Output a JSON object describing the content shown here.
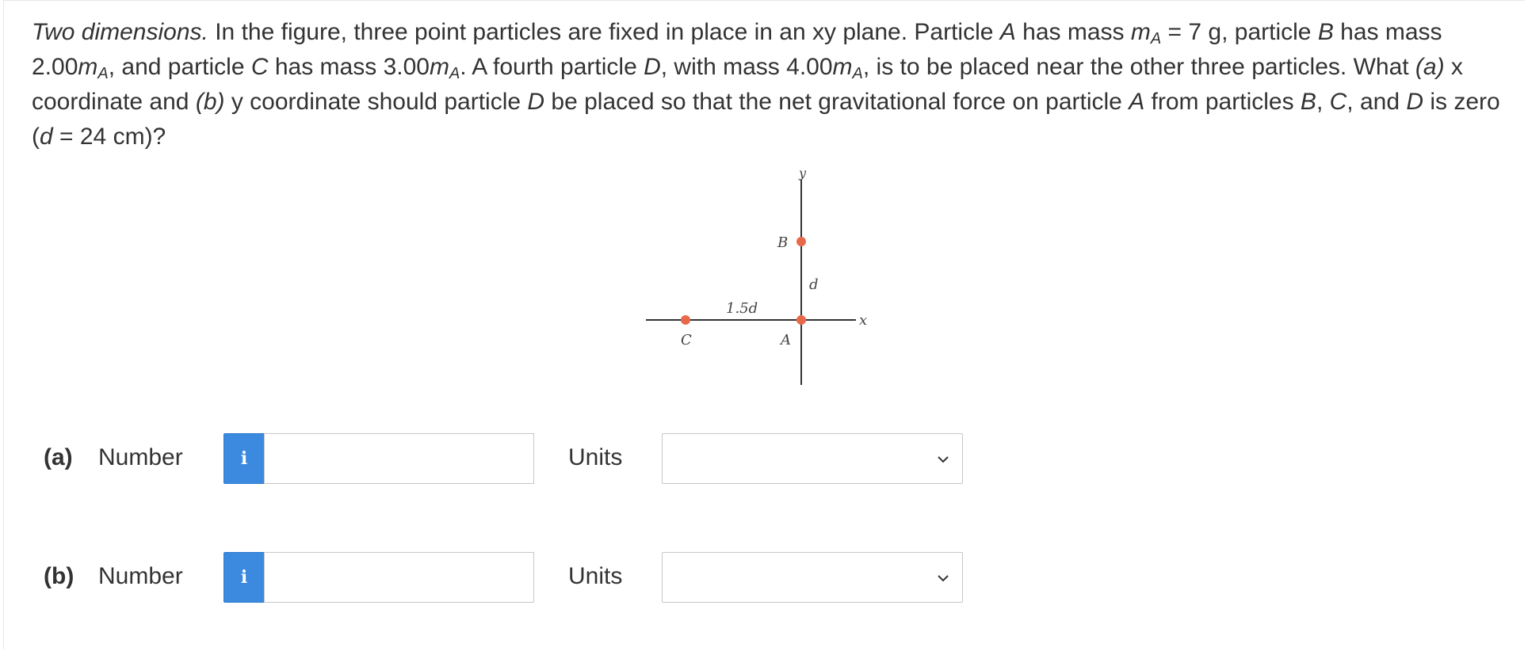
{
  "question": {
    "lead": "Two dimensions.",
    "t1": " In the figure, three point particles are fixed in place in an xy plane. Particle ",
    "A": "A",
    "t2": " has mass ",
    "m": "m",
    "subA": "A",
    "t3": " = 7 g, particle ",
    "B": "B",
    "t4": " has mass 2.00",
    "t5": ", and particle ",
    "C": "C",
    "t6": " has mass 3.00",
    "t7": ". A fourth particle ",
    "D": "D",
    "t8": ", with mass 4.00",
    "t9": ", is to be placed near the other three particles. What ",
    "pa": "(a)",
    "t10": " x coordinate and ",
    "pb": "(b)",
    "t11": " y coordinate should particle ",
    "t12": " be placed so that the net gravitational force on particle ",
    "t13": " from particles ",
    "t14": ", ",
    "t15": ", and ",
    "t16": " is zero (",
    "d": "d",
    "t17": " = 24 cm)?"
  },
  "figure": {
    "y_axis": "y",
    "x_axis": "x",
    "label_B": "B",
    "label_A": "A",
    "label_C": "C",
    "label_d": "d",
    "label_15d": "1.5d",
    "particle_color": "#e8694a"
  },
  "parts": [
    {
      "label": "(a)",
      "number_label": "Number",
      "info_icon": "i",
      "number_value": "",
      "units_label": "Units",
      "units_selected": ""
    },
    {
      "label": "(b)",
      "number_label": "Number",
      "info_icon": "i",
      "number_value": "",
      "units_label": "Units",
      "units_selected": ""
    }
  ],
  "colors": {
    "info_button": "#3b8ae0",
    "text": "#333333"
  }
}
